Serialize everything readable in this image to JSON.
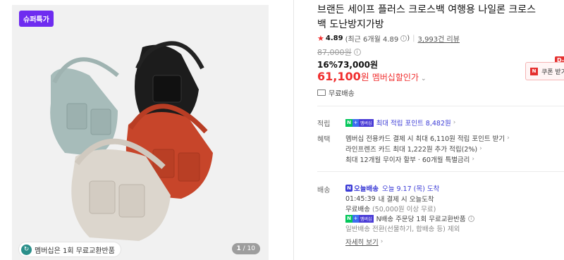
{
  "gallery": {
    "badge": "슈퍼특가",
    "free_exchange": "멤버십은 1회 무료교환반품",
    "pager_current": "1",
    "pager_total": "/ 10"
  },
  "product": {
    "title": "브랜든 세이프 플러스 크로스백 여행용 나일론 크로스백 도난방지가방",
    "rating": "4.89",
    "rating_recent": "(최근 6개월 4.89",
    "reviews": "3,993건 리뷰",
    "original_price": "87,000원",
    "discount_line": "16%73,000원",
    "member_price": "61,100",
    "won": "원",
    "member_label": "멤버십할인가",
    "shipping": "무료배송"
  },
  "coupon": {
    "tag": "D-",
    "label": "쿠폰 받기",
    "logo": "N"
  },
  "points": {
    "label": "적립",
    "badge_n": "N",
    "badge_plus": "+",
    "badge_m": "멤버십",
    "text": "최대 적립 포인트 8,482원"
  },
  "benefits": {
    "label": "혜택",
    "line1": "멤버십 전용카드 결제 시 최대 6,110원 적립 포인트 받기",
    "line2": "라인프렌즈 카드 최대 1,222원 추가 적립(2%)",
    "line3": "최대 12개월 무이자 할부 · 60개월 특별금리"
  },
  "delivery": {
    "label": "배송",
    "today_logo": "오늘배송",
    "today_date": "오늘 9.17 (목) 도착",
    "countdown": "01:45:39",
    "countdown_text": "내 결제 시 오늘도착",
    "free": "무료배송",
    "free_cond": "(50,000원 이상 무료)",
    "n_delivery": "N배송 주문당 1회 무료교환반품",
    "normal": "일반배송 전환(선물하기, 합배송 등) 제외",
    "detail": "자세히 보기"
  }
}
